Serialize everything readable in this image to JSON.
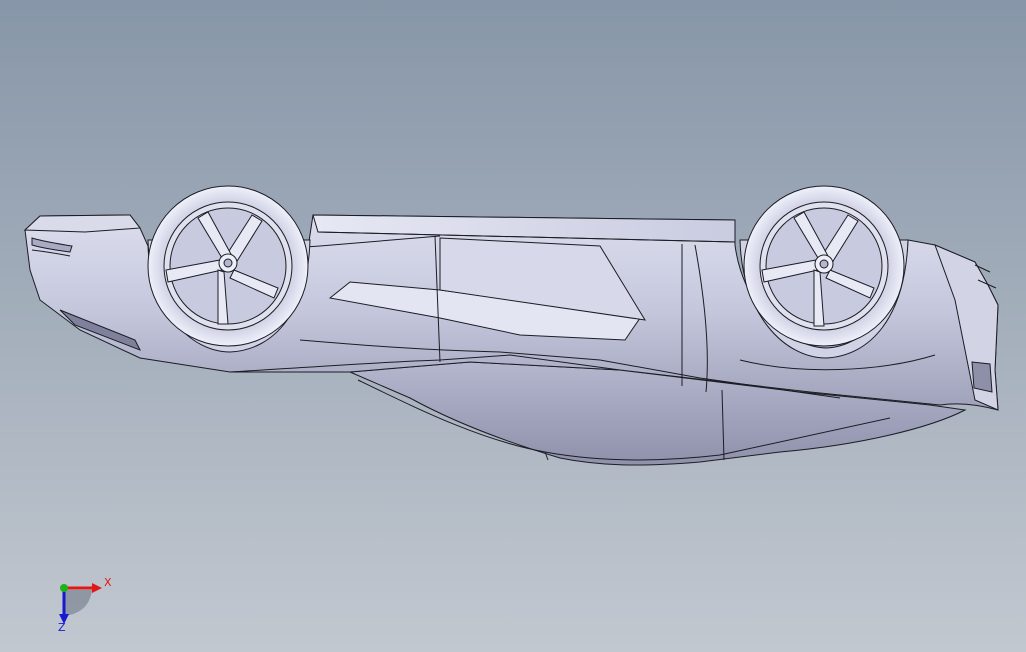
{
  "viewport": {
    "background_top": "#8796a8",
    "background_bottom": "#c2c8d0"
  },
  "model": {
    "body_color": "#c7c9de",
    "edge_color": "#1c1c24",
    "highlight_color": "#eceef8",
    "shadow_color": "#8a8ca4"
  },
  "triad": {
    "x_label": "X",
    "z_label": "Z",
    "x_color": "#e01818",
    "y_color": "#18b418",
    "z_color": "#1818d0"
  }
}
